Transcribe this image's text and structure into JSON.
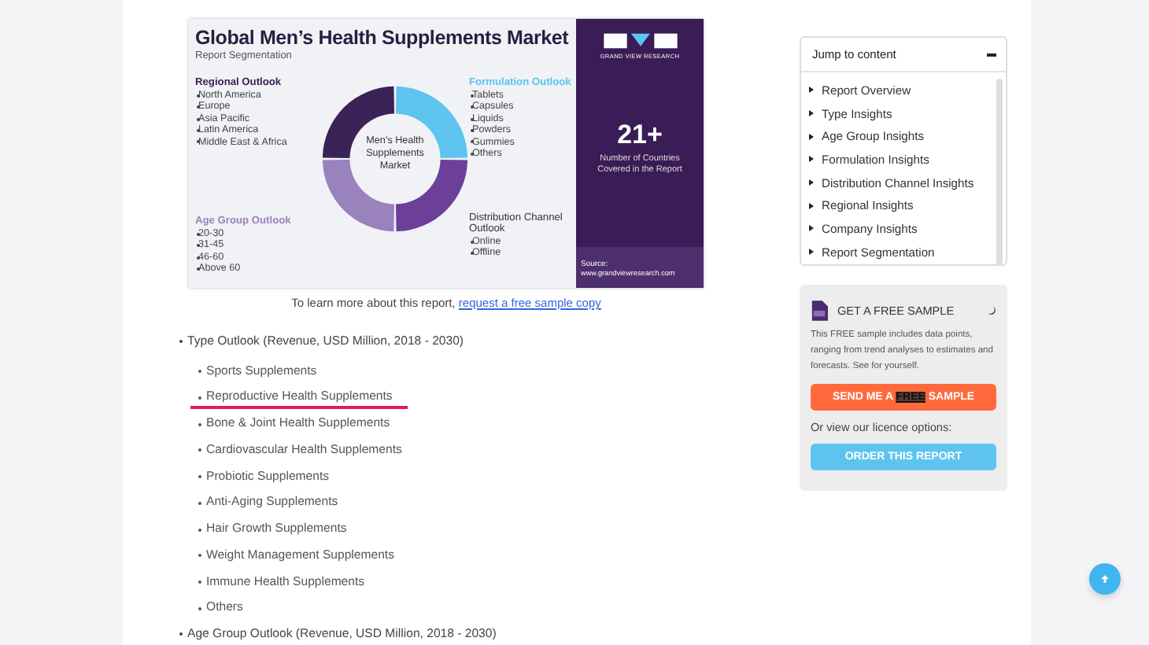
{
  "infographic": {
    "title": "Global Men’s Health Supplements Market",
    "subtitle": "Report Segmentation",
    "center_label": "Men’s Health Supplements Market",
    "segments": [
      {
        "heading": "Regional Outlook",
        "color": "#3b2257",
        "items": [
          "North America",
          "Europe",
          "Asia Pacific",
          "Latin America",
          "Middle East & Africa"
        ]
      },
      {
        "heading": "Formulation Outlook",
        "color": "#5ec4ef",
        "items": [
          "Tablets",
          "Capsules",
          "Liquids",
          "Powders",
          "Gummies",
          "Others"
        ]
      },
      {
        "heading": "Age Group Outlook",
        "color": "#9a82bd",
        "items": [
          "20-30",
          "31-45",
          "46-60",
          "Above 60"
        ]
      },
      {
        "heading": "Distribution Channel Outlook",
        "color": "#6c3f98",
        "items": [
          "Online",
          "Offline"
        ]
      }
    ],
    "brand": "GRAND VIEW RESEARCH",
    "stat": "21+",
    "stat_label": "Number of Countries Covered in the Report",
    "source_label": "Source:",
    "source_url": "www.grandviewresearch.com"
  },
  "caption": {
    "text": "To learn more about this report, ",
    "link": "request a free sample copy"
  },
  "outline": [
    {
      "label": "Type Outlook (Revenue, USD Million, 2018 - 2030)",
      "children": [
        {
          "label": "Sports Supplements",
          "highlighted": false
        },
        {
          "label": "Reproductive Health Supplements",
          "highlighted": true
        },
        {
          "label": "Bone & Joint Health Supplements",
          "highlighted": false
        },
        {
          "label": "Cardiovascular Health Supplements",
          "highlighted": false
        },
        {
          "label": "Probiotic Supplements",
          "highlighted": false
        },
        {
          "label": "Anti-Aging Supplements",
          "highlighted": false
        },
        {
          "label": "Hair Growth Supplements",
          "highlighted": false
        },
        {
          "label": "Weight Management Supplements",
          "highlighted": false
        },
        {
          "label": "Immune Health Supplements",
          "highlighted": false
        },
        {
          "label": "Others",
          "highlighted": false
        }
      ]
    },
    {
      "label": "Age Group Outlook (Revenue, USD Million, 2018 - 2030)"
    }
  ],
  "jump": {
    "title": "Jump to content",
    "expanded": true,
    "items": [
      "Report Overview",
      "Type Insights",
      "Age Group Insights",
      "Formulation Insights",
      "Distribution Channel Insights",
      "Regional Insights",
      "Company Insights",
      "Report Segmentation"
    ]
  },
  "sample": {
    "title": "GET A FREE SAMPLE",
    "description": "This FREE sample includes data points, ranging from trend analyses to estimates and forecasts. See for yourself.",
    "button_before": "SEND ME A ",
    "button_highlight": "FREE",
    "button_after": " SAMPLE",
    "licence_text": "Or view our licence options:",
    "order_button": "ORDER THIS REPORT"
  }
}
